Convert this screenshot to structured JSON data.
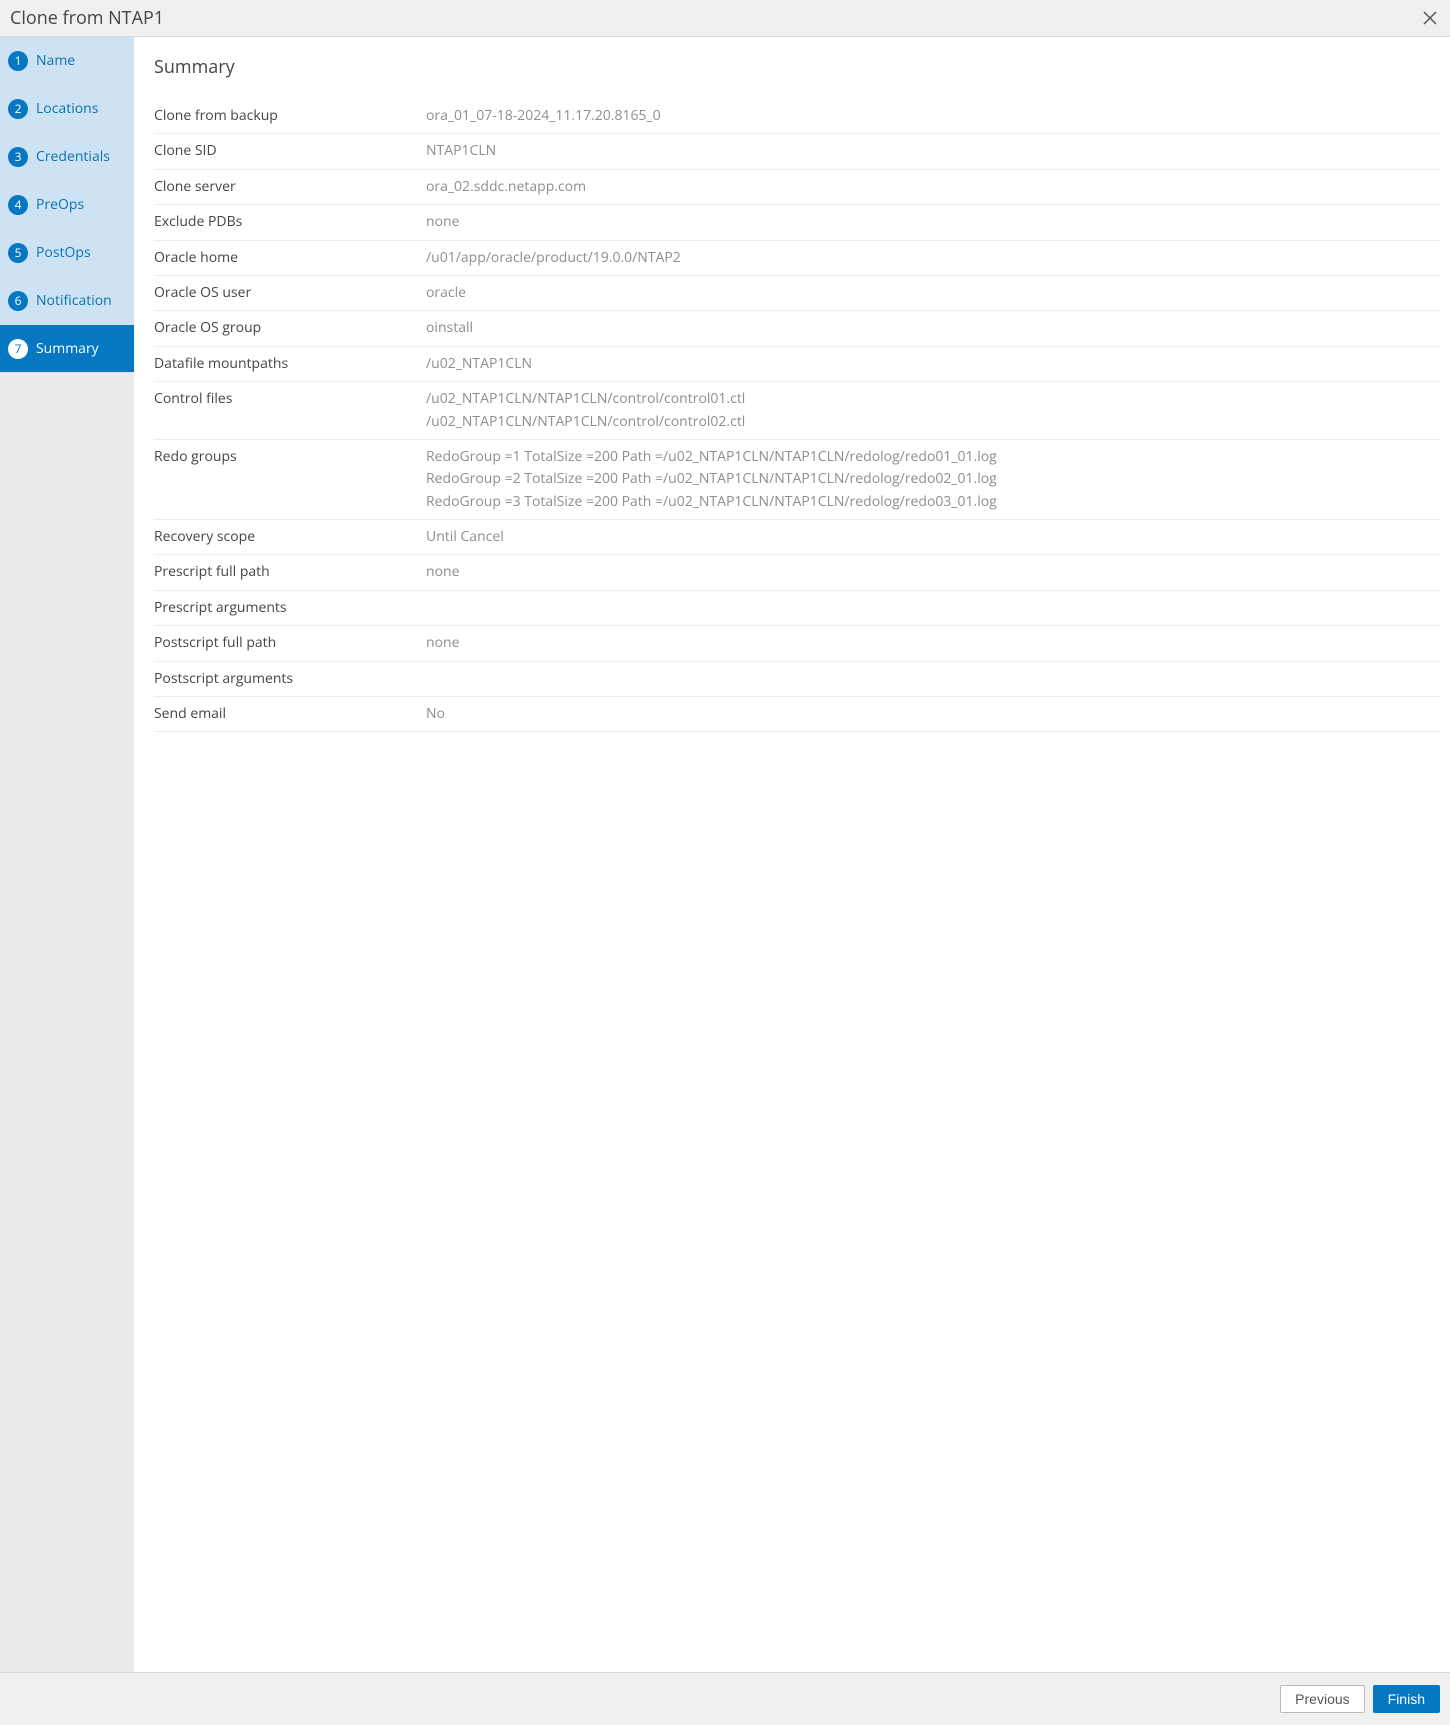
{
  "dialog": {
    "title": "Clone from NTAP1"
  },
  "steps": [
    {
      "num": "1",
      "label": "Name"
    },
    {
      "num": "2",
      "label": "Locations"
    },
    {
      "num": "3",
      "label": "Credentials"
    },
    {
      "num": "4",
      "label": "PreOps"
    },
    {
      "num": "5",
      "label": "PostOps"
    },
    {
      "num": "6",
      "label": "Notification"
    },
    {
      "num": "7",
      "label": "Summary"
    }
  ],
  "main": {
    "heading": "Summary"
  },
  "summary": {
    "clone_from_backup": {
      "label": "Clone from backup",
      "value": "ora_01_07-18-2024_11.17.20.8165_0"
    },
    "clone_sid": {
      "label": "Clone SID",
      "value": "NTAP1CLN"
    },
    "clone_server": {
      "label": "Clone server",
      "value": "ora_02.sddc.netapp.com"
    },
    "exclude_pdbs": {
      "label": "Exclude PDBs",
      "value": "none"
    },
    "oracle_home": {
      "label": "Oracle home",
      "value": "/u01/app/oracle/product/19.0.0/NTAP2"
    },
    "oracle_os_user": {
      "label": "Oracle OS user",
      "value": "oracle"
    },
    "oracle_os_group": {
      "label": "Oracle OS group",
      "value": "oinstall"
    },
    "datafile_mountpaths": {
      "label": "Datafile mountpaths",
      "value": "/u02_NTAP1CLN"
    },
    "control_files": {
      "label": "Control files",
      "lines": [
        "/u02_NTAP1CLN/NTAP1CLN/control/control01.ctl",
        "/u02_NTAP1CLN/NTAP1CLN/control/control02.ctl"
      ]
    },
    "redo_groups": {
      "label": "Redo groups",
      "lines": [
        "RedoGroup =1 TotalSize =200 Path =/u02_NTAP1CLN/NTAP1CLN/redolog/redo01_01.log",
        "RedoGroup =2 TotalSize =200 Path =/u02_NTAP1CLN/NTAP1CLN/redolog/redo02_01.log",
        "RedoGroup =3 TotalSize =200 Path =/u02_NTAP1CLN/NTAP1CLN/redolog/redo03_01.log"
      ]
    },
    "recovery_scope": {
      "label": "Recovery scope",
      "value": "Until Cancel"
    },
    "prescript_full_path": {
      "label": "Prescript full path",
      "value": "none"
    },
    "prescript_arguments": {
      "label": "Prescript arguments",
      "value": ""
    },
    "postscript_full_path": {
      "label": "Postscript full path",
      "value": "none"
    },
    "postscript_arguments": {
      "label": "Postscript arguments",
      "value": ""
    },
    "send_email": {
      "label": "Send email",
      "value": "No"
    }
  },
  "footer": {
    "previous": "Previous",
    "finish": "Finish"
  }
}
